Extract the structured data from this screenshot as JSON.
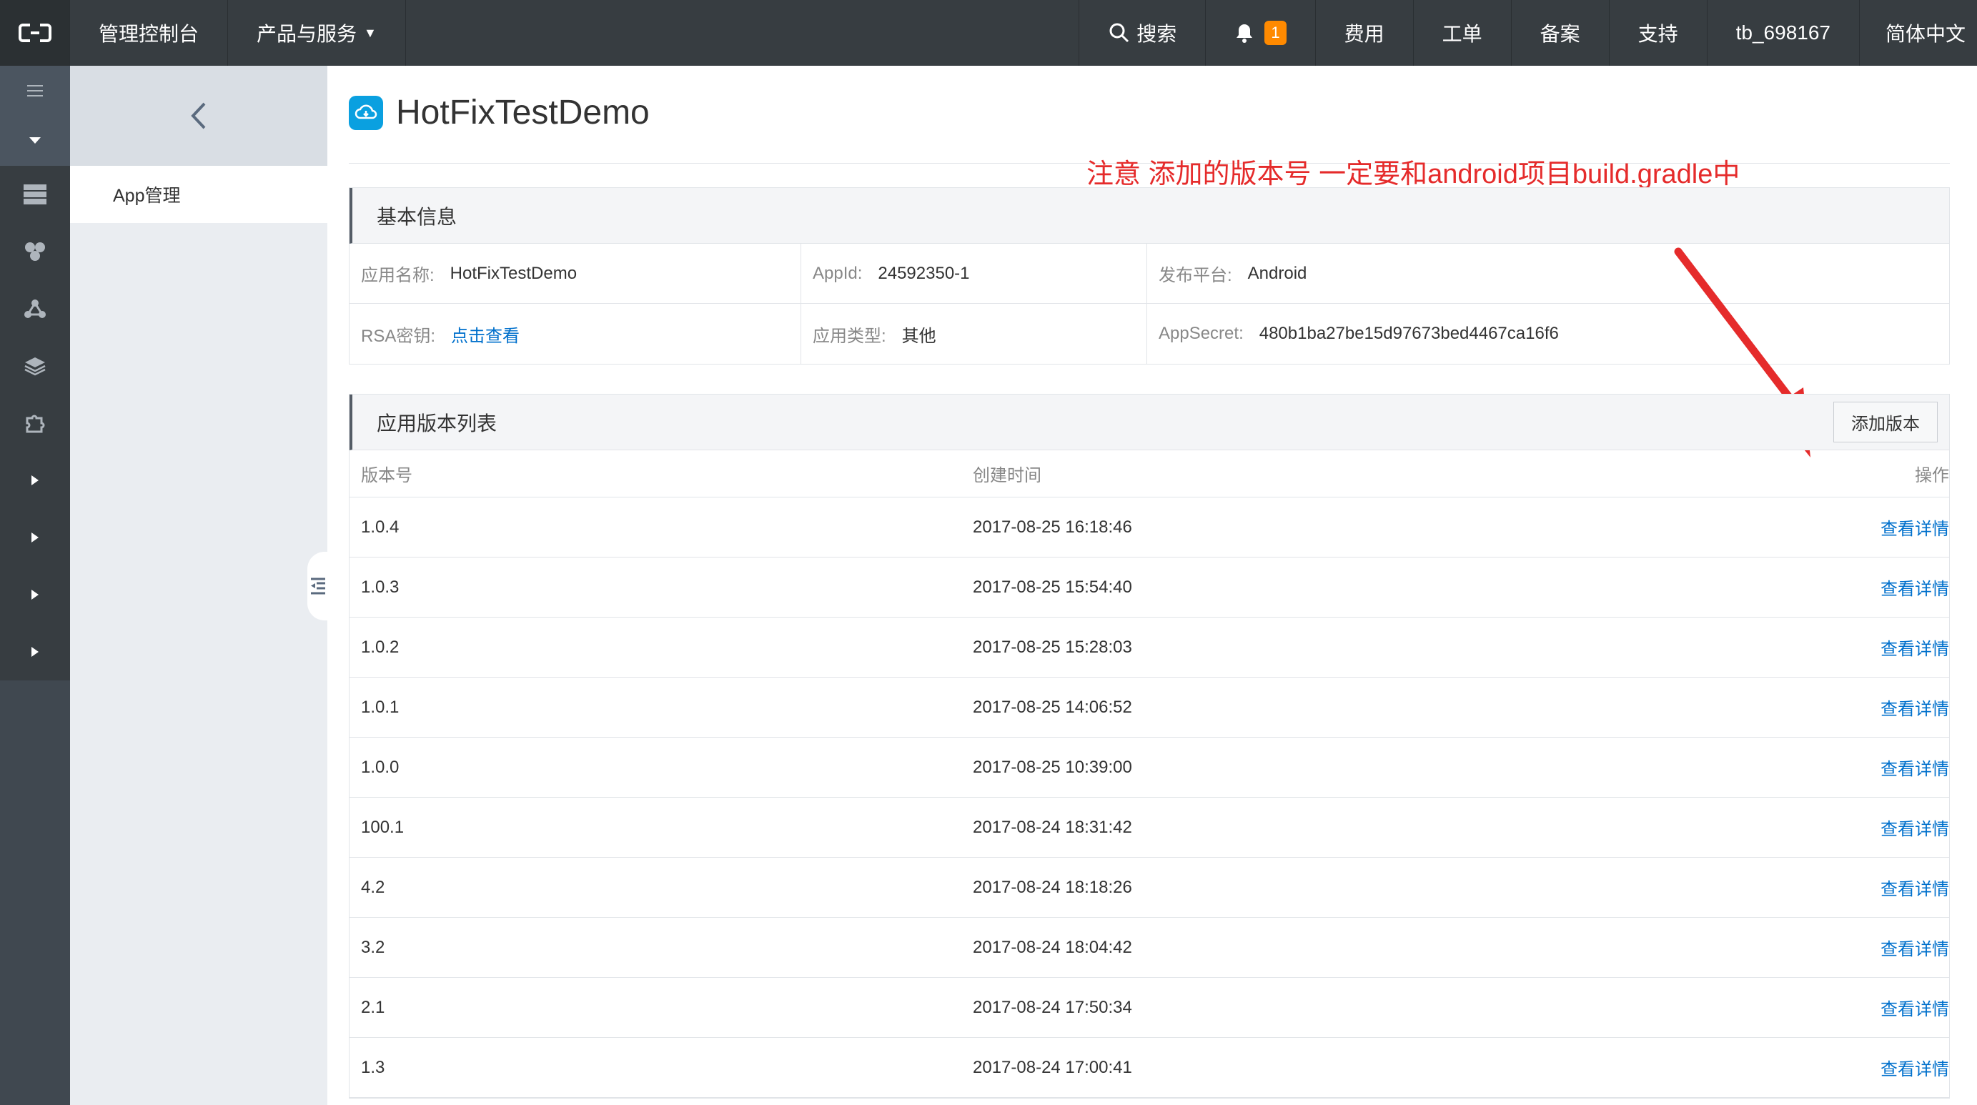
{
  "topbar": {
    "console": "管理控制台",
    "products": "产品与服务",
    "search": "搜索",
    "notification_count": "1",
    "fees": "费用",
    "tickets": "工单",
    "icp": "备案",
    "support": "支持",
    "user": "tb_698167",
    "language": "简体中文"
  },
  "subnav": {
    "item": "App管理"
  },
  "app": {
    "title": "HotFixTestDemo"
  },
  "annotation": "注意 添加的版本号 一定要和android项目build.gradle中versionName相对应。",
  "basic": {
    "heading": "基本信息",
    "app_name_label": "应用名称:",
    "app_name": "HotFixTestDemo",
    "appid_label": "AppId:",
    "appid": "24592350-1",
    "platform_label": "发布平台:",
    "platform": "Android",
    "rsa_label": "RSA密钥:",
    "rsa_link": "点击查看",
    "type_label": "应用类型:",
    "type": "其他",
    "secret_label": "AppSecret:",
    "secret": "480b1ba27be15d97673bed4467ca16f6"
  },
  "versions": {
    "heading": "应用版本列表",
    "add_button": "添加版本",
    "columns": [
      "版本号",
      "创建时间",
      "操作"
    ],
    "rows": [
      {
        "version": "1.0.4",
        "created": "2017-08-25 16:18:46",
        "action": "查看详情"
      },
      {
        "version": "1.0.3",
        "created": "2017-08-25 15:54:40",
        "action": "查看详情"
      },
      {
        "version": "1.0.2",
        "created": "2017-08-25 15:28:03",
        "action": "查看详情"
      },
      {
        "version": "1.0.1",
        "created": "2017-08-25 14:06:52",
        "action": "查看详情"
      },
      {
        "version": "1.0.0",
        "created": "2017-08-25 10:39:00",
        "action": "查看详情"
      },
      {
        "version": "100.1",
        "created": "2017-08-24 18:31:42",
        "action": "查看详情"
      },
      {
        "version": "4.2",
        "created": "2017-08-24 18:18:26",
        "action": "查看详情"
      },
      {
        "version": "3.2",
        "created": "2017-08-24 18:04:42",
        "action": "查看详情"
      },
      {
        "version": "2.1",
        "created": "2017-08-24 17:50:34",
        "action": "查看详情"
      },
      {
        "version": "1.3",
        "created": "2017-08-24 17:00:41",
        "action": "查看详情"
      }
    ]
  },
  "colors": {
    "topbar": "#373d41",
    "link": "#0070cc",
    "annotation": "#e52b2b",
    "badge": "#ff8a00"
  }
}
